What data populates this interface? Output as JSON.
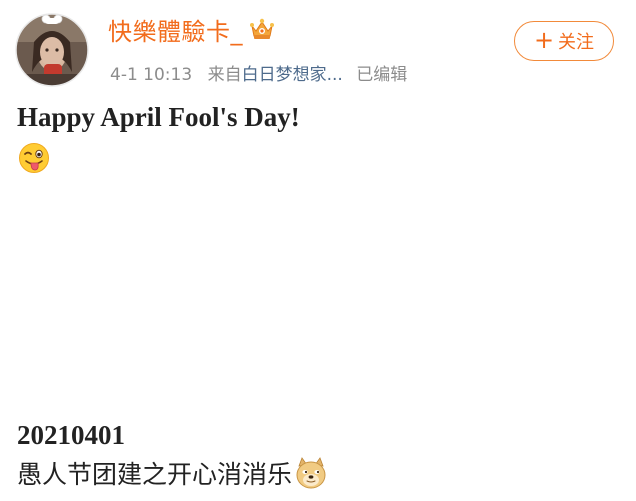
{
  "header": {
    "username": "快樂體驗卡_",
    "time": "4-1 10:13",
    "source_label": "来自",
    "source_app": "白日梦想家...",
    "edited_label": "已编辑",
    "follow": {
      "plus": "+",
      "label": "关注"
    },
    "icons": {
      "avatar": "avatar",
      "badge": "crown-badge-icon"
    }
  },
  "post": {
    "title": "Happy April Fool's Day!",
    "title_emoji": "winking-tongue-emoji",
    "date_line": "20210401",
    "caption": "愚人节团建之开心消消乐",
    "caption_emoji": "doge-emoji"
  },
  "colors": {
    "username": "#f26c1c",
    "follow_border": "#f28a3a",
    "source_link": "#4e6b8c",
    "meta_gray": "#8c8c8c"
  }
}
